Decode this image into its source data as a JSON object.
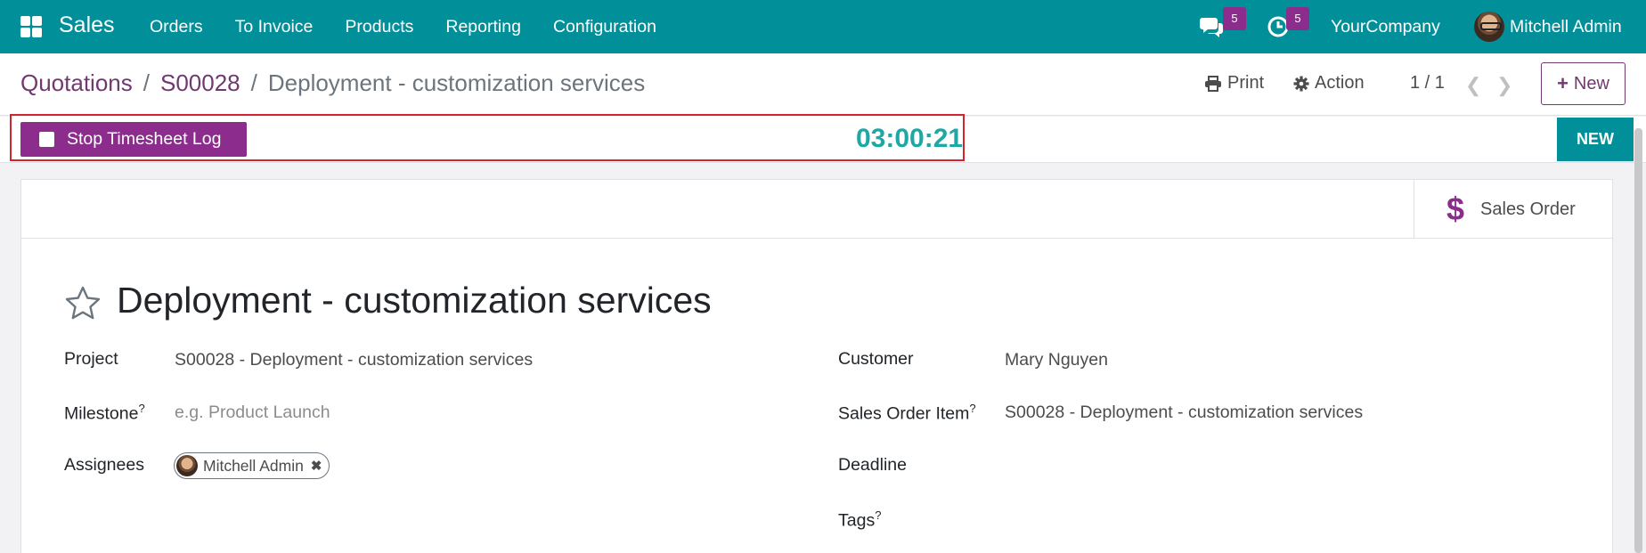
{
  "navbar": {
    "app_name": "Sales",
    "menu": [
      "Orders",
      "To Invoice",
      "Products",
      "Reporting",
      "Configuration"
    ],
    "messages_count": "5",
    "activities_count": "5",
    "company": "YourCompany",
    "user": "Mitchell Admin",
    "bg_color": "#018f9a"
  },
  "breadcrumb": {
    "root": "Quotations",
    "order": "S00028",
    "current": "Deployment - customization services"
  },
  "control": {
    "print_label": "Print",
    "action_label": "Action",
    "pager": "1 / 1",
    "new_label": "New"
  },
  "statusbar": {
    "stop_label": "Stop Timesheet Log",
    "timer": "03:00:21",
    "stage": "NEW"
  },
  "smart_button": {
    "icon": "dollar-icon",
    "label": "Sales Order"
  },
  "task": {
    "title": "Deployment - customization services",
    "fields": {
      "project_label": "Project",
      "project_value": "S00028 - Deployment - customization services",
      "milestone_label": "Milestone",
      "milestone_help": "?",
      "milestone_placeholder": "e.g. Product Launch",
      "assignees_label": "Assignees",
      "assignee": "Mitchell Admin",
      "customer_label": "Customer",
      "customer_value": "Mary Nguyen",
      "so_item_label": "Sales Order Item",
      "so_item_help": "?",
      "so_item_value": "S00028 - Deployment - customization services",
      "deadline_label": "Deadline",
      "tags_label": "Tags",
      "tags_help": "?"
    }
  },
  "colors": {
    "primary": "#71396f",
    "button_purple": "#8c2c8c",
    "timer": "#1ea8a5",
    "highlight": "#d0252f"
  }
}
